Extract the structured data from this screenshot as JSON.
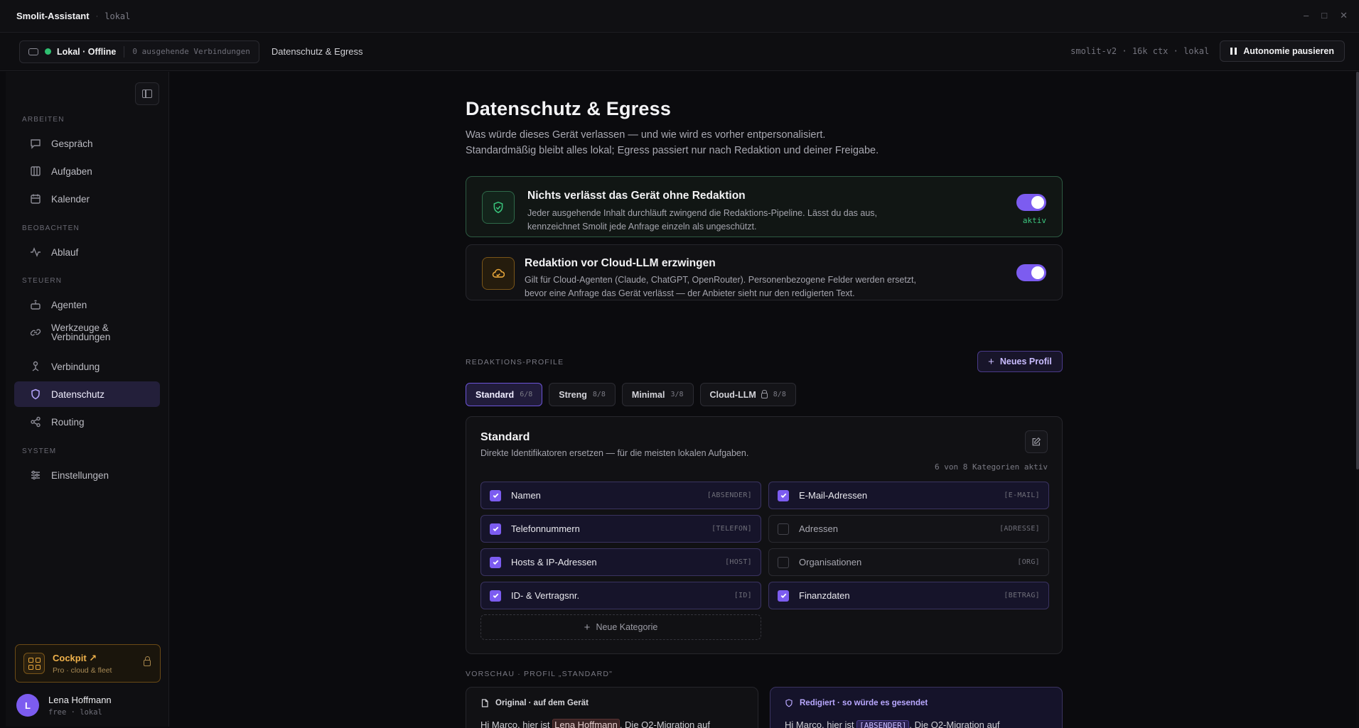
{
  "window": {
    "app_name": "Smolit-Assistant",
    "mode": "lokal"
  },
  "header": {
    "status": "Lokal · Offline",
    "connections": "0 ausgehende Verbindungen",
    "breadcrumb": "Datenschutz & Egress",
    "model_info": "smolit-v2 · 16k ctx · lokal",
    "pause_label": "Autonomie pausieren"
  },
  "sidebar": {
    "sections": {
      "arbeiten": "ARBEITEN",
      "beobachten": "BEOBACHTEN",
      "steuern": "STEUERN",
      "system": "SYSTEM"
    },
    "items": {
      "gespraech": "Gespräch",
      "aufgaben": "Aufgaben",
      "kalender": "Kalender",
      "ablauf": "Ablauf",
      "agenten": "Agenten",
      "werkzeuge": "Werkzeuge &",
      "werkzeuge2": "Verbindungen",
      "verbindung": "Verbindung",
      "datenschutz": "Datenschutz",
      "routing": "Routing",
      "einstellungen": "Einstellungen"
    },
    "active_item": "Datenschutz",
    "cockpit": {
      "title": "Cockpit ↗",
      "subtitle": "Pro · cloud & fleet"
    },
    "user": {
      "initial": "L",
      "name": "Lena Hoffmann",
      "plan": "free · lokal"
    }
  },
  "page": {
    "title": "Datenschutz & Egress",
    "lead1": "Was würde dieses Gerät verlassen — und wie wird es vorher entpersonalisiert.",
    "lead2": "Standardmäßig bleibt alles lokal; Egress passiert nur nach Redaktion und deiner Freigabe.",
    "card1": {
      "title": "Nichts verlässt das Gerät ohne Redaktion",
      "desc1": "Jeder ausgehende Inhalt durchläuft zwingend die Redaktions-Pipeline. Lässt du das aus,",
      "desc2": "kennzeichnet Smolit jede Anfrage einzeln als ungeschützt.",
      "status": "aktiv",
      "enabled": true
    },
    "card2": {
      "title": "Redaktion vor Cloud-LLM erzwingen",
      "desc1": "Gilt für Cloud-Agenten (Claude, ChatGPT, OpenRouter). Personenbezogene Felder werden ersetzt,",
      "desc2": "bevor eine Anfrage das Gerät verlässt — der Anbieter sieht nur den redigierten Text.",
      "enabled": true
    },
    "profiles_label": "REDAKTIONS-PROFILE",
    "new_profile": "Neues Profil",
    "tabs": [
      {
        "label": "Standard",
        "count": "6/8"
      },
      {
        "label": "Streng",
        "count": "8/8"
      },
      {
        "label": "Minimal",
        "count": "3/8"
      },
      {
        "label": "Cloud-LLM",
        "count": "8/8"
      }
    ],
    "profile": {
      "title": "Standard",
      "desc": "Direkte Identifikatoren ersetzen — für die meisten lokalen Aufgaben.",
      "count": "6 von 8 Kategorien aktiv",
      "categories": [
        {
          "label": "Namen",
          "tag": "[ABSENDER]",
          "checked": true
        },
        {
          "label": "E-Mail-Adressen",
          "tag": "[E-MAIL]",
          "checked": true
        },
        {
          "label": "Telefonnummern",
          "tag": "[TELEFON]",
          "checked": true
        },
        {
          "label": "Adressen",
          "tag": "[ADRESSE]",
          "checked": false
        },
        {
          "label": "Hosts & IP-Adressen",
          "tag": "[HOST]",
          "checked": true
        },
        {
          "label": "Organisationen",
          "tag": "[ORG]",
          "checked": false
        },
        {
          "label": "ID- & Vertragsnr.",
          "tag": "[ID]",
          "checked": true
        },
        {
          "label": "Finanzdaten",
          "tag": "[BETRAG]",
          "checked": true
        }
      ],
      "new_category": "Neue Kategorie"
    },
    "preview": {
      "label": "VORSCHAU · PROFIL „STANDARD\"",
      "original_title": "Original · auf dem Gerät",
      "original_pre": "Hi Marco, hier ist ",
      "original_name": "Lena Hoffmann",
      "original_post": ". Die Q2-Migration auf",
      "redacted_title": "Redigiert · so würde es gesendet",
      "redacted_pre": "Hi Marco, hier ist ",
      "redacted_tag": "[ABSENDER]",
      "redacted_post": ". Die Q2-Migration auf"
    }
  },
  "colors": {
    "accent": "#7c5cf0",
    "success": "#39c27a",
    "warning": "#e7a63a"
  }
}
